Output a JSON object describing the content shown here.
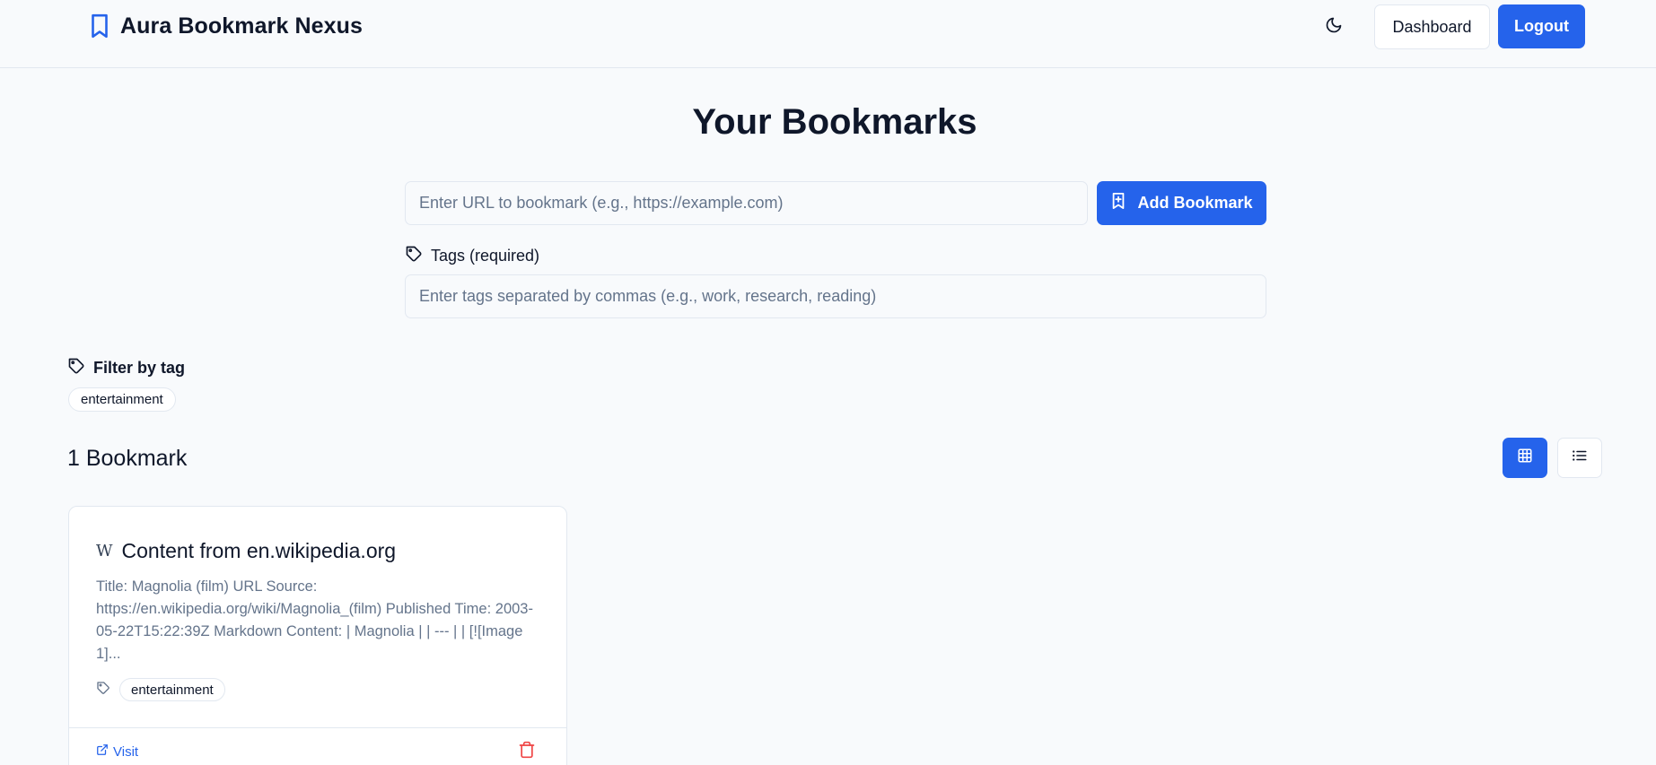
{
  "header": {
    "app_title": "Aura Bookmark Nexus",
    "dashboard_label": "Dashboard",
    "logout_label": "Logout",
    "brand_color": "#2563eb"
  },
  "main": {
    "title": "Your Bookmarks",
    "url_input": {
      "placeholder": "Enter URL to bookmark (e.g., https://example.com)",
      "value": ""
    },
    "add_button_label": "Add Bookmark",
    "tags_label": "Tags (required)",
    "tags_input": {
      "placeholder": "Enter tags separated by commas (e.g., work, research, reading)",
      "value": ""
    }
  },
  "filter": {
    "label": "Filter by tag",
    "tags": [
      "entertainment"
    ]
  },
  "bookmarks": {
    "count_label": "1 Bookmark",
    "view_mode": "grid",
    "items": [
      {
        "favicon": "W",
        "title": "Content from en.wikipedia.org",
        "description": "Title: Magnolia (film) URL Source: https://en.wikipedia.org/wiki/Magnolia_(film) Published Time: 2003-05-22T15:22:39Z Markdown Content: | Magnolia | | --- | | [![Image 1]...",
        "tags": [
          "entertainment"
        ],
        "visit_label": "Visit"
      }
    ]
  },
  "icons": {
    "brand": "bookmark-icon",
    "theme": "moon-icon",
    "add": "bookmark-plus-icon",
    "tag": "tag-icon",
    "grid": "grid-icon",
    "list": "list-icon",
    "visit": "external-link-icon",
    "delete": "trash-icon"
  },
  "colors": {
    "primary": "#2563eb",
    "danger": "#ef4444",
    "muted_text": "#64748b",
    "border": "#e2e8f0"
  }
}
